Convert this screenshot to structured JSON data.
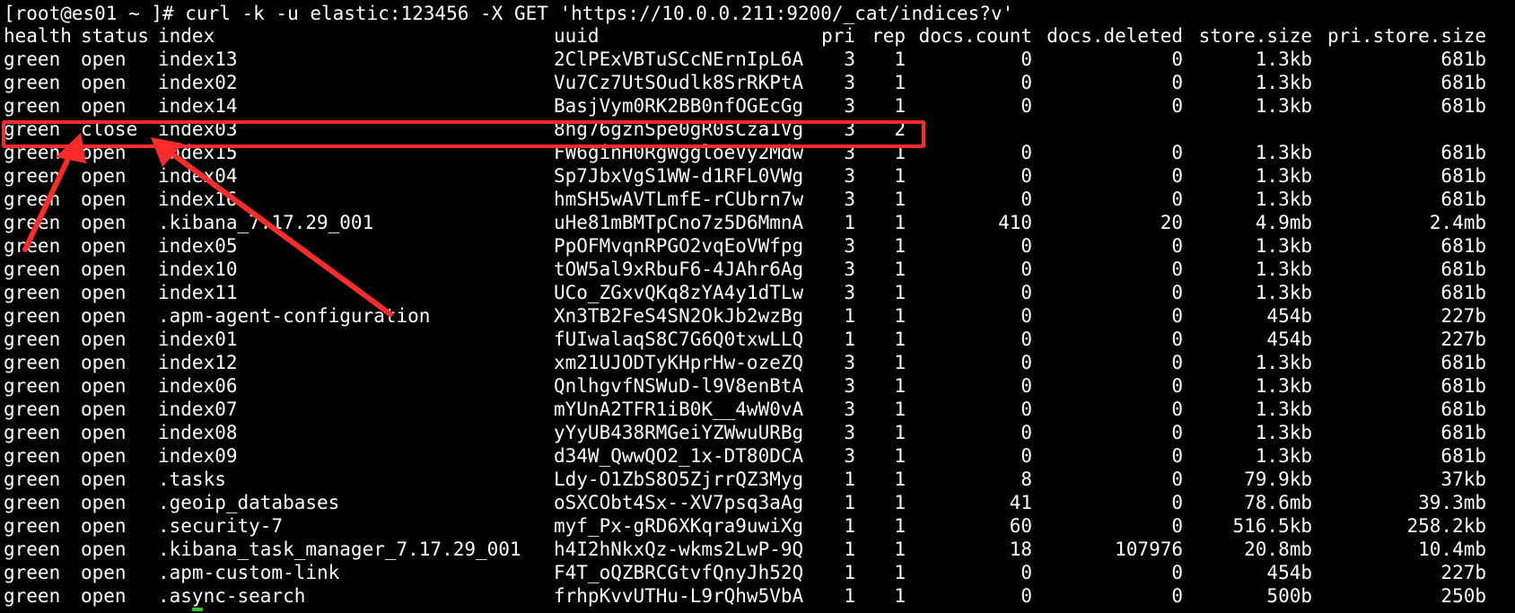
{
  "terminal": {
    "command_line": "[root@es01 ~ ]# curl -k -u elastic:123456 -X GET 'https://10.0.0.211:9200/_cat/indices?v'",
    "headers": {
      "health": "health",
      "status": "status",
      "index": "index",
      "uuid": "uuid",
      "pri": "pri",
      "rep": "rep",
      "docs_count": "docs.count",
      "docs_deleted": "docs.deleted",
      "store_size": "store.size",
      "pri_store_size": "pri.store.size"
    },
    "rows": [
      {
        "health": "green",
        "status": "open",
        "index": "index13",
        "uuid": "2ClPExVBTuSCcNErnIpL6A",
        "pri": "3",
        "rep": "1",
        "docs_count": "0",
        "docs_deleted": "0",
        "store_size": "1.3kb",
        "pri_store_size": "681b"
      },
      {
        "health": "green",
        "status": "open",
        "index": "index02",
        "uuid": "Vu7Cz7UtSOudlk8SrRKPtA",
        "pri": "3",
        "rep": "1",
        "docs_count": "0",
        "docs_deleted": "0",
        "store_size": "1.3kb",
        "pri_store_size": "681b"
      },
      {
        "health": "green",
        "status": "open",
        "index": "index14",
        "uuid": "BasjVym0RK2BB0nfOGEcGg",
        "pri": "3",
        "rep": "1",
        "docs_count": "0",
        "docs_deleted": "0",
        "store_size": "1.3kb",
        "pri_store_size": "681b"
      },
      {
        "health": "green",
        "status": "close",
        "index": "index03",
        "uuid": "8hg76gznSpe0gR0sCza1Vg",
        "pri": "3",
        "rep": "2",
        "docs_count": "",
        "docs_deleted": "",
        "store_size": "",
        "pri_store_size": ""
      },
      {
        "health": "green",
        "status": "open",
        "index": "index15",
        "uuid": "FW6ginH0RgWggloeVy2Mdw",
        "pri": "3",
        "rep": "1",
        "docs_count": "0",
        "docs_deleted": "0",
        "store_size": "1.3kb",
        "pri_store_size": "681b"
      },
      {
        "health": "green",
        "status": "open",
        "index": "index04",
        "uuid": "Sp7JbxVgS1WW-d1RFL0VWg",
        "pri": "3",
        "rep": "1",
        "docs_count": "0",
        "docs_deleted": "0",
        "store_size": "1.3kb",
        "pri_store_size": "681b"
      },
      {
        "health": "green",
        "status": "open",
        "index": "index16",
        "uuid": "hmSH5wAVTLmfE-rCUbrn7w",
        "pri": "3",
        "rep": "1",
        "docs_count": "0",
        "docs_deleted": "0",
        "store_size": "1.3kb",
        "pri_store_size": "681b"
      },
      {
        "health": "green",
        "status": "open",
        "index": ".kibana_7.17.29_001",
        "uuid": "uHe81mBMTpCno7z5D6MmnA",
        "pri": "1",
        "rep": "1",
        "docs_count": "410",
        "docs_deleted": "20",
        "store_size": "4.9mb",
        "pri_store_size": "2.4mb"
      },
      {
        "health": "green",
        "status": "open",
        "index": "index05",
        "uuid": "PpOFMvqnRPGO2vqEoVWfpg",
        "pri": "3",
        "rep": "1",
        "docs_count": "0",
        "docs_deleted": "0",
        "store_size": "1.3kb",
        "pri_store_size": "681b"
      },
      {
        "health": "green",
        "status": "open",
        "index": "index10",
        "uuid": "tOW5al9xRbuF6-4JAhr6Ag",
        "pri": "3",
        "rep": "1",
        "docs_count": "0",
        "docs_deleted": "0",
        "store_size": "1.3kb",
        "pri_store_size": "681b"
      },
      {
        "health": "green",
        "status": "open",
        "index": "index11",
        "uuid": "UCo_ZGxvQKq8zYA4y1dTLw",
        "pri": "3",
        "rep": "1",
        "docs_count": "0",
        "docs_deleted": "0",
        "store_size": "1.3kb",
        "pri_store_size": "681b"
      },
      {
        "health": "green",
        "status": "open",
        "index": ".apm-agent-configuration",
        "uuid": "Xn3TB2FeS4SN2OkJb2wzBg",
        "pri": "1",
        "rep": "1",
        "docs_count": "0",
        "docs_deleted": "0",
        "store_size": "454b",
        "pri_store_size": "227b"
      },
      {
        "health": "green",
        "status": "open",
        "index": "index01",
        "uuid": "fUIwalaqS8C7G6Q0txwLLQ",
        "pri": "1",
        "rep": "1",
        "docs_count": "0",
        "docs_deleted": "0",
        "store_size": "454b",
        "pri_store_size": "227b"
      },
      {
        "health": "green",
        "status": "open",
        "index": "index12",
        "uuid": "xm21UJODTyKHprHw-ozeZQ",
        "pri": "3",
        "rep": "1",
        "docs_count": "0",
        "docs_deleted": "0",
        "store_size": "1.3kb",
        "pri_store_size": "681b"
      },
      {
        "health": "green",
        "status": "open",
        "index": "index06",
        "uuid": "QnlhgvfNSWuD-l9V8enBtA",
        "pri": "3",
        "rep": "1",
        "docs_count": "0",
        "docs_deleted": "0",
        "store_size": "1.3kb",
        "pri_store_size": "681b"
      },
      {
        "health": "green",
        "status": "open",
        "index": "index07",
        "uuid": "mYUnA2TFR1iB0K__4wW0vA",
        "pri": "3",
        "rep": "1",
        "docs_count": "0",
        "docs_deleted": "0",
        "store_size": "1.3kb",
        "pri_store_size": "681b"
      },
      {
        "health": "green",
        "status": "open",
        "index": "index08",
        "uuid": "yYyUB438RMGeiYZWwuURBg",
        "pri": "3",
        "rep": "1",
        "docs_count": "0",
        "docs_deleted": "0",
        "store_size": "1.3kb",
        "pri_store_size": "681b"
      },
      {
        "health": "green",
        "status": "open",
        "index": "index09",
        "uuid": "d34W_QwwQO2_1x-DT80DCA",
        "pri": "3",
        "rep": "1",
        "docs_count": "0",
        "docs_deleted": "0",
        "store_size": "1.3kb",
        "pri_store_size": "681b"
      },
      {
        "health": "green",
        "status": "open",
        "index": ".tasks",
        "uuid": "Ldy-O1ZbS8O5ZjrrQZ3Myg",
        "pri": "1",
        "rep": "1",
        "docs_count": "8",
        "docs_deleted": "0",
        "store_size": "79.9kb",
        "pri_store_size": "37kb"
      },
      {
        "health": "green",
        "status": "open",
        "index": ".geoip_databases",
        "uuid": "oSXCObt4Sx--XV7psq3aAg",
        "pri": "1",
        "rep": "1",
        "docs_count": "41",
        "docs_deleted": "0",
        "store_size": "78.6mb",
        "pri_store_size": "39.3mb"
      },
      {
        "health": "green",
        "status": "open",
        "index": ".security-7",
        "uuid": "myf_Px-gRD6XKqra9uwiXg",
        "pri": "1",
        "rep": "1",
        "docs_count": "60",
        "docs_deleted": "0",
        "store_size": "516.5kb",
        "pri_store_size": "258.2kb"
      },
      {
        "health": "green",
        "status": "open",
        "index": ".kibana_task_manager_7.17.29_001",
        "uuid": "h4I2hNkxQz-wkms2LwP-9Q",
        "pri": "1",
        "rep": "1",
        "docs_count": "18",
        "docs_deleted": "107976",
        "store_size": "20.8mb",
        "pri_store_size": "10.4mb"
      },
      {
        "health": "green",
        "status": "open",
        "index": ".apm-custom-link",
        "uuid": "F4T_oQZBRCGtvfQnyJh52Q",
        "pri": "1",
        "rep": "1",
        "docs_count": "0",
        "docs_deleted": "0",
        "store_size": "454b",
        "pri_store_size": "227b"
      },
      {
        "health": "green",
        "status": "open",
        "index": ".async-search",
        "uuid": "frhpKvvUTHu-L9rQhw5VbA",
        "pri": "1",
        "rep": "1",
        "docs_count": "0",
        "docs_deleted": "0",
        "store_size": "500b",
        "pri_store_size": "250b"
      }
    ],
    "colors": {
      "background": "#000000",
      "text": "#ffffff",
      "annotation": "#ff2a2a",
      "cursor": "#22cc22"
    }
  }
}
